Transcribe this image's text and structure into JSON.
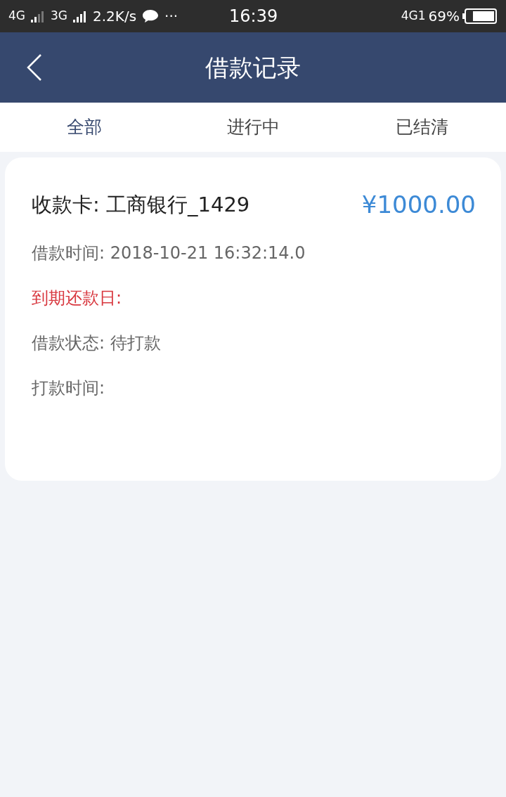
{
  "status_bar": {
    "left": [
      {
        "kind": "network",
        "text": "4G"
      },
      {
        "kind": "network",
        "text": "3G"
      },
      {
        "kind": "speed",
        "text": "2.2K/s"
      },
      {
        "kind": "more",
        "text": "···"
      }
    ],
    "time": "16:39",
    "right_network": "4G1",
    "battery": "69%"
  },
  "header": {
    "title": "借款记录"
  },
  "tabs": [
    {
      "label": "全部",
      "selected": true
    },
    {
      "label": "进行中",
      "selected": false
    },
    {
      "label": "已结清",
      "selected": false
    }
  ],
  "records": [
    {
      "card": "收款卡: 工商银行_1429",
      "amount": "¥1000.00",
      "details": [
        {
          "kind": "normal",
          "text": "借款时间: 2018-10-21 16:32:14.0"
        },
        {
          "kind": "alert",
          "text": "到期还款日:"
        },
        {
          "kind": "normal",
          "text": "借款状态: 待打款"
        },
        {
          "kind": "normal",
          "text": "打款时间:"
        }
      ]
    }
  ]
}
